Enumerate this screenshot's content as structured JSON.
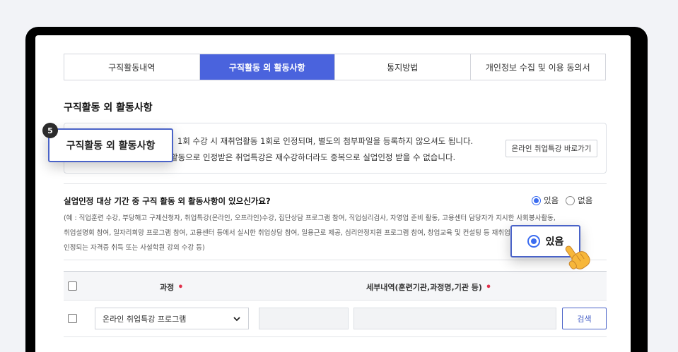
{
  "tabs": [
    {
      "label": "구직활동내역"
    },
    {
      "label": "구직활동 외 활동사항"
    },
    {
      "label": "통지방법"
    },
    {
      "label": "개인정보 수집 및 이용 동의서"
    }
  ],
  "active_tab_index": 1,
  "section_title": "구직활동 외 활동사항",
  "info": {
    "line1": "1회 수강 시 재취업활동 1회로 인정되며, 별도의 첨부파일을 등록하지 않으셔도 됩니다.",
    "line2": "활동으로 인정받은 취업특강은 재수강하더라도 중복으로 실업인정 받을 수 없습니다.",
    "link_button": "온라인 취업특강 바로가기"
  },
  "callout_step": {
    "number": "5",
    "label": "구직활동 외 활동사항"
  },
  "question": {
    "text": "실업인정 대상 기간 중 구직 활동 외 활동사항이 있으신가요?",
    "options": [
      "있음",
      "없음"
    ],
    "selected": "있음"
  },
  "example_lines": [
    "(예 : 직업훈련 수강, 부당해고 구제신청자, 취업특강(온라인, 오프라인)수강, 집단상담 프로그램 참여, 직업심리검사, 자영업 준비 활동, 고용센터 담당자가 지시한 사회봉사활동,",
    "취업설명회 참여, 일자리희망 프로그램 참여, 고용센터 등에서 실시한 취업상담 참여, 일용근로 제공, 심리안정지원 프로그램 참여, 창업교육 및 컨설팅 등 재취업 활동으로 인정하다고",
    "인정되는 자격증 취득 또는 사설학원 강의 수강 등)"
  ],
  "callout_yes": {
    "label": "있음"
  },
  "table": {
    "headers": [
      "과정",
      "세부내역(훈련기관,과정명,기관 등)"
    ],
    "row": {
      "select_value": "온라인 취업특강 프로그램",
      "search_button": "검색"
    }
  },
  "colors": {
    "accent": "#4a63dd",
    "required": "#e0304a",
    "radio": "#3b6cf0"
  }
}
